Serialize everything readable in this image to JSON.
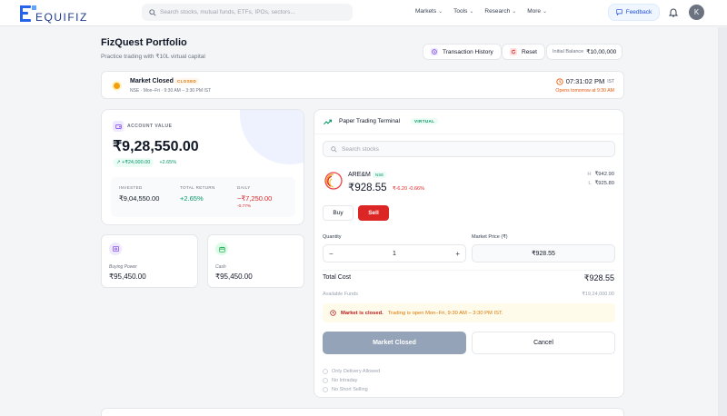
{
  "header": {
    "logo_text": "EQUIFIZ",
    "search_placeholder": "Search stocks, mutual funds, ETFs, IPOs, sectors...",
    "nav": [
      {
        "label": "Markets"
      },
      {
        "label": "Tools"
      },
      {
        "label": "Research"
      },
      {
        "label": "More"
      }
    ],
    "feedback_label": "Feedback",
    "avatar_initial": "K"
  },
  "page": {
    "title": "FizQuest Portfolio",
    "subtitle": "Practice trading with ₹10L virtual capital",
    "transaction_history_label": "Transaction History",
    "reset_label": "Reset",
    "initial_balance_label": "Initial Balance",
    "initial_balance_value": "₹10,00,000"
  },
  "market": {
    "title": "Market Closed",
    "badge": "CLOSED",
    "hours": "NSE · Mon–Fri · 9:30 AM – 3:30 PM IST",
    "clock": "07:31:02 PM",
    "tz": "IST",
    "opens": "Opens tomorrow at 9:30 AM"
  },
  "account": {
    "label": "ACCOUNT VALUE",
    "value": "₹9,28,550.00",
    "change_abs": "+₹24,000.00",
    "change_pct": "+2.65%",
    "invested_label": "INVESTED",
    "invested_value": "₹9,04,550.00",
    "return_label": "TOTAL RETURN",
    "return_value": "+2.65%",
    "daily_label": "DAILY",
    "daily_value": "−₹7,250.00",
    "daily_pct": "-0.77%"
  },
  "buying_power": {
    "label": "Buying Power",
    "value": "₹95,450.00"
  },
  "cash": {
    "label": "Cash",
    "value": "₹95,450.00"
  },
  "terminal": {
    "title": "Paper Trading Terminal",
    "badge": "VIRTUAL",
    "search_placeholder": "Search stocks",
    "stock": {
      "symbol": "ARE&M",
      "exchange": "NSE",
      "price": "₹928.55",
      "change": "₹-6.20 -0.66%",
      "high_key": "H",
      "high": "₹942.90",
      "low_key": "L",
      "low": "₹925.80"
    },
    "buy_label": "Buy",
    "sell_label": "Sell",
    "quantity_label": "Quantity",
    "quantity_value": "1",
    "minus": "−",
    "plus": "+",
    "market_price_label": "Market Price (₹)",
    "market_price_value": "₹928.55",
    "total_cost_label": "Total Cost",
    "total_cost_value": "₹928.55",
    "available_label": "Available Funds",
    "available_value": "₹19,24,000.00",
    "warning_bold": "Market is closed.",
    "warning_rest": "Trading is open Mon–Fri, 9:30 AM – 3:30 PM IST.",
    "market_closed_btn": "Market Closed",
    "cancel_btn": "Cancel",
    "rules": [
      "Only Delivery Allowed",
      "No Intraday",
      "No Short Selling"
    ]
  },
  "colors": {
    "accent": "#2563eb",
    "sell": "#dc2626",
    "positive": "#059669",
    "warning": "#f59e0b"
  }
}
